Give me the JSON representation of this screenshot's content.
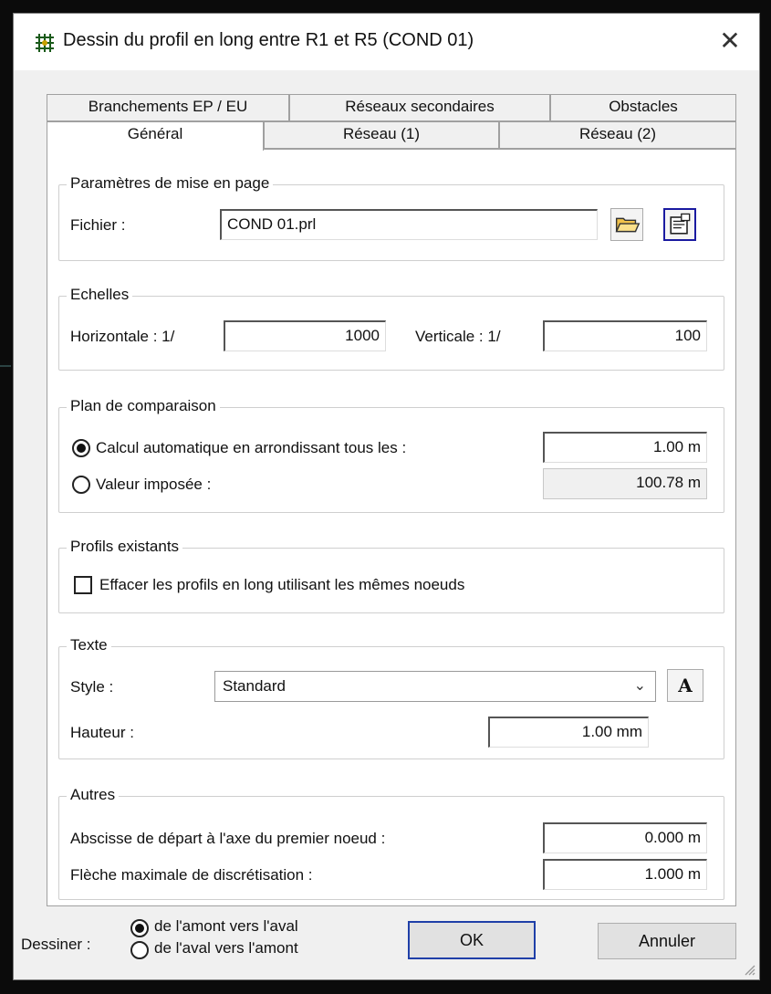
{
  "window": {
    "title": "Dessin du profil en long entre R1 et R5 (COND 01)",
    "close_glyph": "✕",
    "icon": "grid-app-icon"
  },
  "tabs": {
    "row_back": [
      "Branchements EP / EU",
      "Réseaux secondaires",
      "Obstacles"
    ],
    "row_front": [
      "Général",
      "Réseau (1)",
      "Réseau (2)"
    ],
    "active": "Général"
  },
  "mise_en_page": {
    "legend": "Paramètres de mise en page",
    "file_label": "Fichier :",
    "file_value": "COND 01.prl",
    "open_icon": "folder-open-icon",
    "props_icon": "properties-icon"
  },
  "echelles": {
    "legend": "Echelles",
    "horizontal_label": "Horizontale : 1/",
    "horizontal_value": "1000",
    "vertical_label": "Verticale : 1/",
    "vertical_value": "100"
  },
  "plan": {
    "legend": "Plan de comparaison",
    "auto_label": "Calcul automatique en arrondissant tous les :",
    "auto_value": "1.00 m",
    "auto_checked": true,
    "imposed_label": "Valeur imposée :",
    "imposed_value": "100.78 m"
  },
  "profils": {
    "legend": "Profils existants",
    "erase_label": "Effacer les profils en long utilisant les mêmes noeuds",
    "erase_checked": false
  },
  "texte": {
    "legend": "Texte",
    "style_label": "Style :",
    "style_value": "Standard",
    "font_button": "A",
    "height_label": "Hauteur :",
    "height_value": "1.00 mm"
  },
  "autres": {
    "legend": "Autres",
    "start_label": "Abscisse de départ à l'axe du premier noeud :",
    "start_value": "0.000 m",
    "arrow_label": "Flèche maximale de discrétisation :",
    "arrow_value": "1.000 m"
  },
  "footer": {
    "draw_label": "Dessiner :",
    "option_upstream": "de l'amont vers l'aval",
    "option_downstream": "de l'aval vers l'amont",
    "selected": "upstream",
    "ok": "OK",
    "cancel": "Annuler"
  }
}
